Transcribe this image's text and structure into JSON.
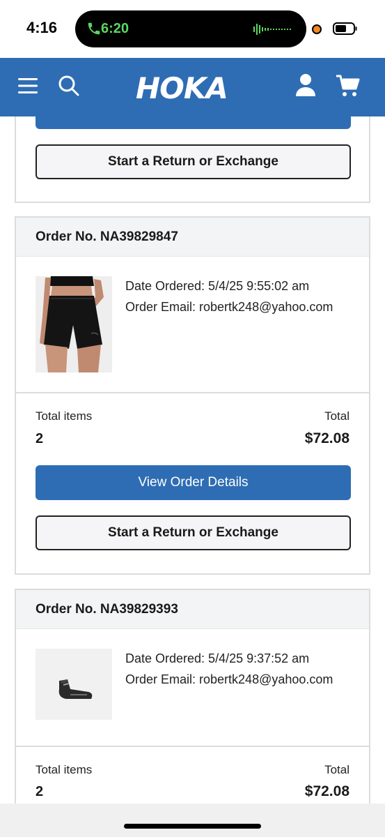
{
  "status_bar": {
    "time": "4:16",
    "call_time": "6:20",
    "call_color": "#5bd660"
  },
  "header": {
    "brand": "HOKA",
    "background_color": "#2e6db4",
    "icons": [
      "menu-icon",
      "search-icon",
      "user-icon",
      "cart-icon"
    ]
  },
  "orders": {
    "previous": {
      "return_label": "Start a Return or Exchange"
    },
    "items": [
      {
        "order_no": "Order No. NA39829847",
        "date_ordered": "Date Ordered: 5/4/25 9:55:02 am",
        "order_email": "Order Email: robertk248@yahoo.com",
        "product_image": "black-shorts-photo",
        "total_items_label": "Total items",
        "total_items": "2",
        "total_label": "Total",
        "total": "$72.08",
        "view_details_label": "View Order Details",
        "return_label": "Start a Return or Exchange"
      },
      {
        "order_no": "Order No. NA39829393",
        "date_ordered": "Date Ordered: 5/4/25 9:37:52 am",
        "order_email": "Order Email: robertk248@yahoo.com",
        "product_image": "sock-photo",
        "total_items_label": "Total items",
        "total_items": "2",
        "total_label": "Total",
        "total": "$72.08"
      }
    ]
  }
}
